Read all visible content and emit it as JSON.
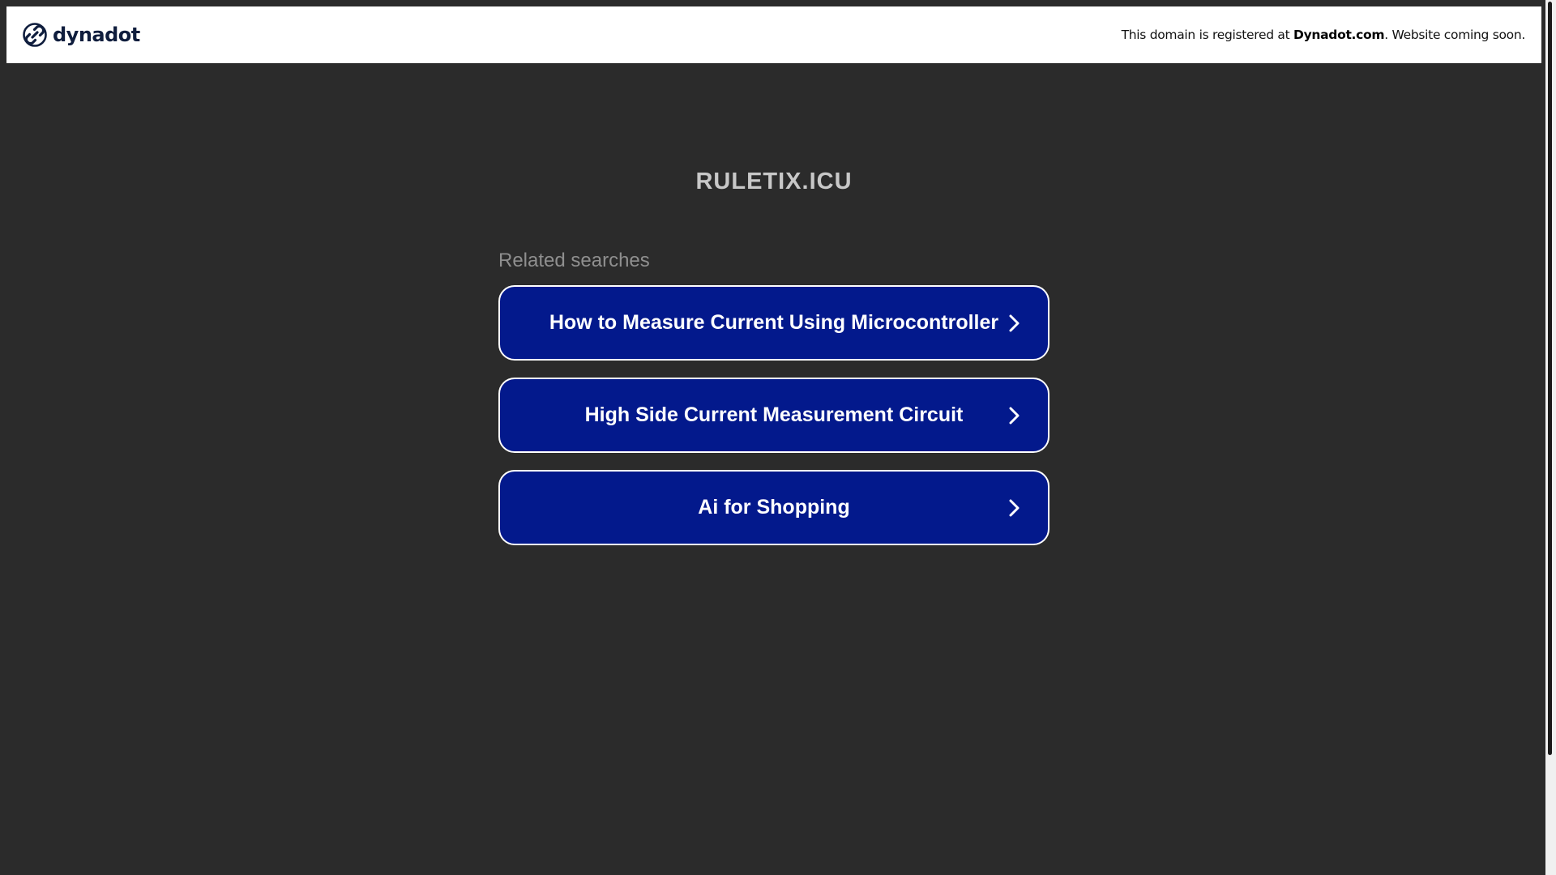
{
  "header": {
    "logo_text": "dynadot",
    "logo_icon": "dynadot-link-icon",
    "notice_prefix": "This domain is registered at ",
    "notice_brand": "Dynadot.com",
    "notice_suffix": ". Website coming soon."
  },
  "main": {
    "domain": "RULETIX.ICU",
    "related_heading": "Related searches",
    "links": [
      {
        "label": "How to Measure Current Using Microcontroller",
        "icon": "chevron-right-icon"
      },
      {
        "label": "High Side Current Measurement Circuit",
        "icon": "chevron-right-icon"
      },
      {
        "label": "Ai for Shopping",
        "icon": "chevron-right-icon"
      }
    ]
  },
  "colors": {
    "background": "#2b2b2b",
    "button_fill": "#03198c",
    "button_border": "#ffffff",
    "header_bg": "#ffffff",
    "domain_text": "#c8c8c8",
    "related_text": "#8f8f8f"
  }
}
